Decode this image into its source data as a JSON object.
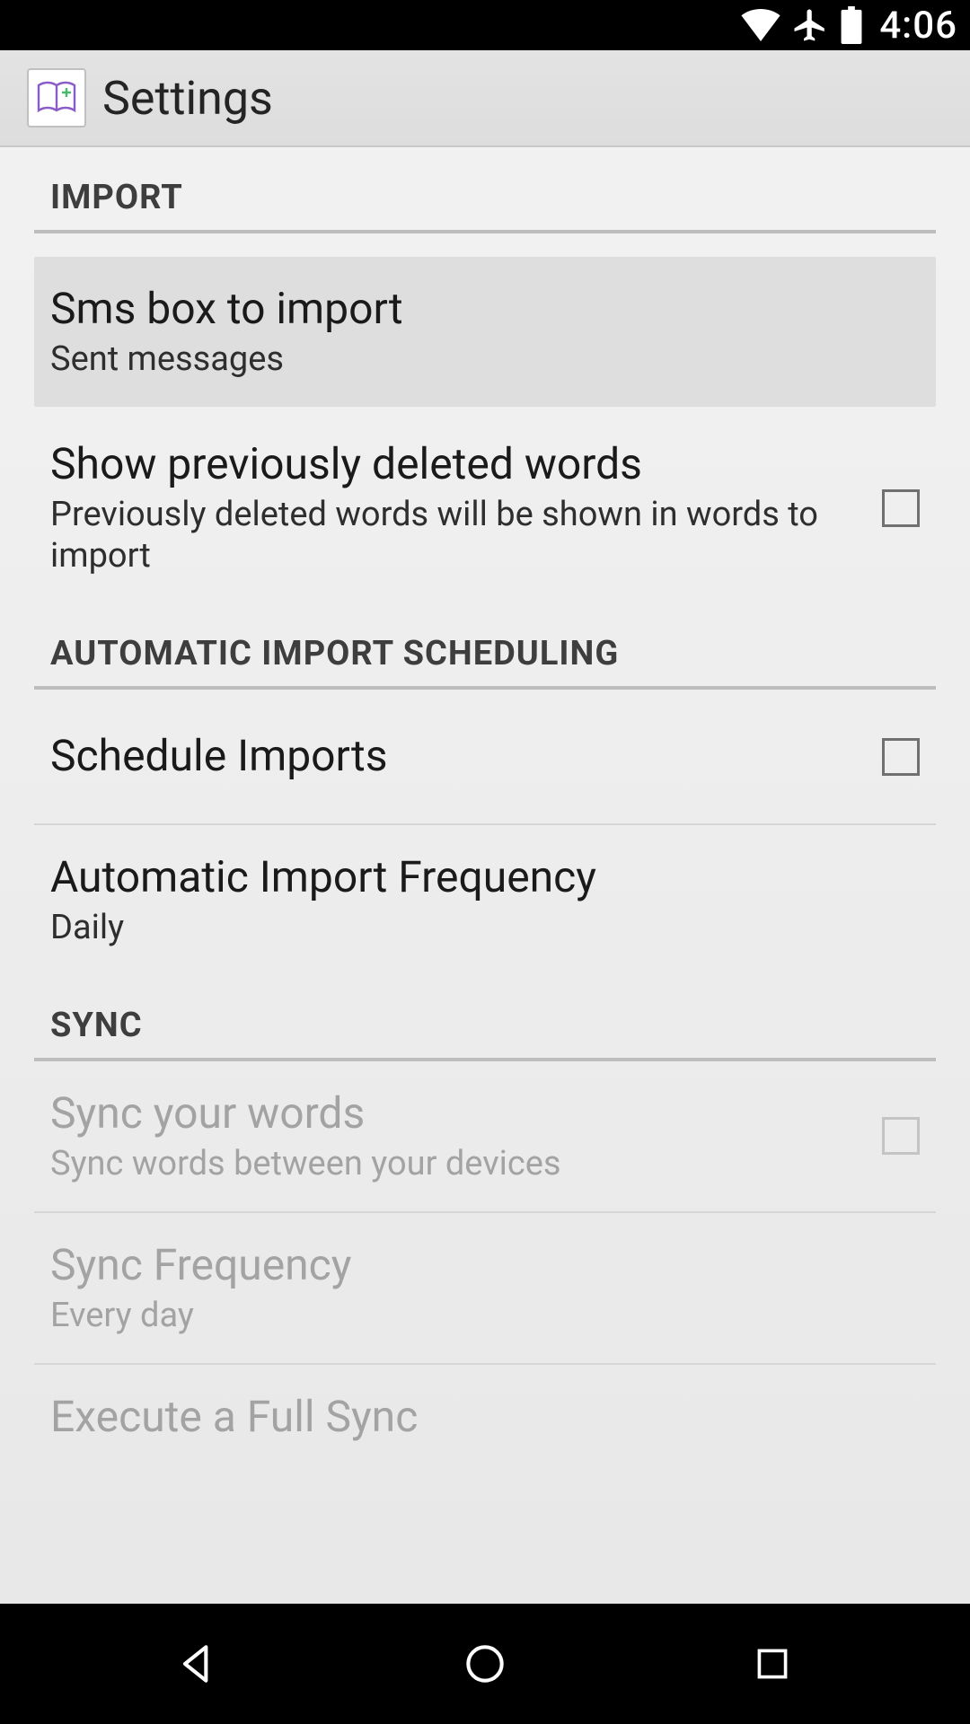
{
  "statusbar": {
    "time": "4:06"
  },
  "header": {
    "title": "Settings"
  },
  "sections": {
    "import": {
      "header": "IMPORT",
      "smsbox": {
        "title": "Sms box to import",
        "summary": "Sent messages"
      },
      "show_deleted": {
        "title": "Show previously deleted words",
        "summary": "Previously deleted words will be shown in words to import"
      }
    },
    "auto": {
      "header": "AUTOMATIC IMPORT SCHEDULING",
      "schedule": {
        "title": "Schedule Imports"
      },
      "frequency": {
        "title": "Automatic Import Frequency",
        "summary": "Daily"
      }
    },
    "sync": {
      "header": "SYNC",
      "sync_words": {
        "title": "Sync your words",
        "summary": "Sync words between your devices"
      },
      "sync_freq": {
        "title": "Sync Frequency",
        "summary": "Every day"
      },
      "full_sync": {
        "title": "Execute a Full Sync"
      }
    }
  }
}
